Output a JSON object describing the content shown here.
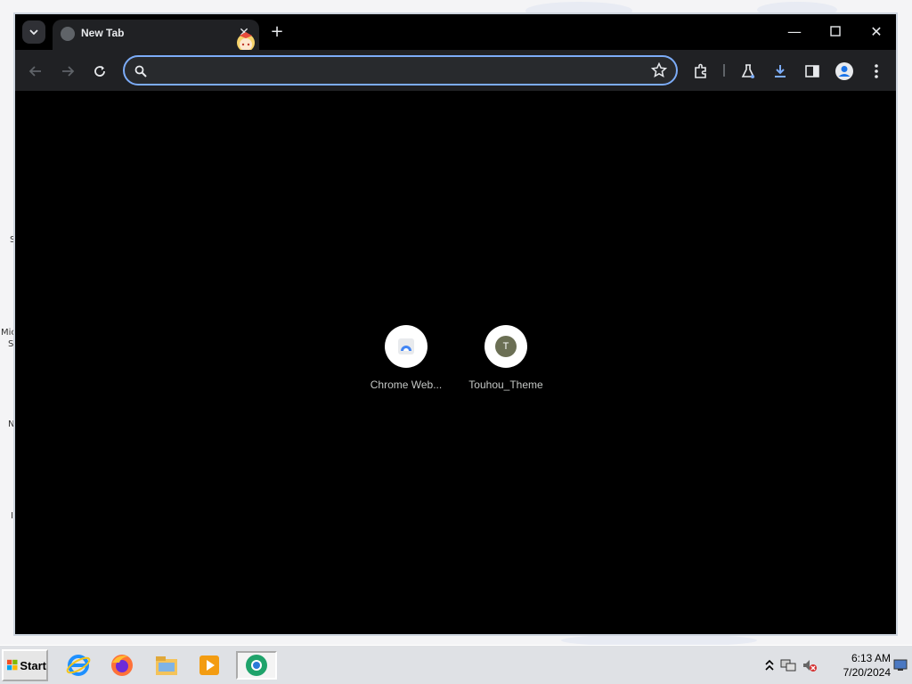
{
  "browser": {
    "tab": {
      "title": "New Tab"
    },
    "omnibox": {
      "value": "",
      "placeholder": ""
    },
    "shortcuts": [
      {
        "label": "Chrome Web...",
        "icon": "chrome-web-store-icon"
      },
      {
        "label": "Touhou_Theme",
        "icon": "letter-avatar",
        "letter": "T"
      }
    ]
  },
  "desktop": {
    "edge_labels": [
      "S",
      "Mic",
      "S",
      "N",
      "I"
    ]
  },
  "taskbar": {
    "start_label": "Start",
    "apps": [
      "internet-explorer-icon",
      "firefox-icon",
      "file-explorer-icon",
      "media-player-icon",
      "chrome-icon"
    ],
    "clock": {
      "time": "6:13 AM",
      "date": "7/20/2024"
    }
  },
  "colors": {
    "accent": "#7cacf8",
    "toolbar": "#202124",
    "page_bg": "#000000"
  }
}
